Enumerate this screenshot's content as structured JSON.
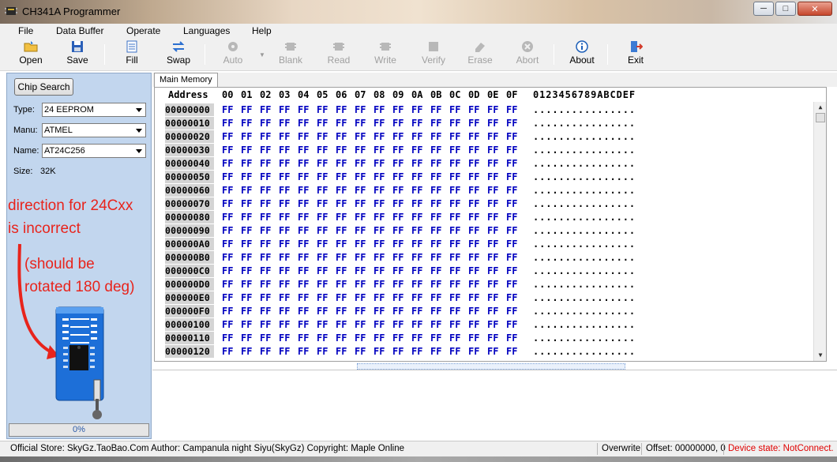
{
  "window": {
    "title": "CH341A Programmer",
    "controls": [
      "minimize",
      "maximize",
      "close"
    ]
  },
  "menu": [
    {
      "label": "File"
    },
    {
      "label": "Data Buffer"
    },
    {
      "label": "Operate"
    },
    {
      "label": "Languages"
    },
    {
      "label": "Help"
    }
  ],
  "toolbar": {
    "items": [
      {
        "label": "Open",
        "icon": "open-folder-icon",
        "enabled": true
      },
      {
        "label": "Save",
        "icon": "floppy-disk-icon",
        "enabled": true
      },
      {
        "label": "Fill",
        "icon": "fill-icon",
        "enabled": true
      },
      {
        "label": "Swap",
        "icon": "swap-arrows-icon",
        "enabled": true
      },
      {
        "label": "Auto",
        "icon": "auto-gear-icon",
        "enabled": false
      },
      {
        "label": "Blank",
        "icon": "blank-chip-icon",
        "enabled": false
      },
      {
        "label": "Read",
        "icon": "read-chip-icon",
        "enabled": false
      },
      {
        "label": "Write",
        "icon": "write-chip-icon",
        "enabled": false
      },
      {
        "label": "Verify",
        "icon": "verify-chip-icon",
        "enabled": false
      },
      {
        "label": "Erase",
        "icon": "erase-icon",
        "enabled": false
      },
      {
        "label": "Abort",
        "icon": "abort-icon",
        "enabled": false
      },
      {
        "label": "About",
        "icon": "info-icon",
        "enabled": true
      },
      {
        "label": "Exit",
        "icon": "exit-icon",
        "enabled": true
      }
    ]
  },
  "chip_panel": {
    "chip_search_label": "Chip Search",
    "type_label": "Type:",
    "type_value": "24 EEPROM",
    "manu_label": "Manu:",
    "manu_value": "ATMEL",
    "name_label": "Name:",
    "name_value": "AT24C256",
    "size_label": "Size:",
    "size_value": "32K",
    "annotation_line1": "direction for 24Cxx",
    "annotation_line2": "is incorrect",
    "annotation_line3": "(should be",
    "annotation_line4": "rotated 180 deg)",
    "progress_text": "0%",
    "progress_fraction": 0
  },
  "memory": {
    "tab_label": "Main Memory",
    "address_header": "Address",
    "column_headers": [
      "00",
      "01",
      "02",
      "03",
      "04",
      "05",
      "06",
      "07",
      "08",
      "09",
      "0A",
      "0B",
      "0C",
      "0D",
      "0E",
      "0F"
    ],
    "ascii_header": "0123456789ABCDEF",
    "rows": [
      {
        "address": "00000000",
        "ascii": "................"
      },
      {
        "address": "00000010",
        "ascii": "................"
      },
      {
        "address": "00000020",
        "ascii": "................"
      },
      {
        "address": "00000030",
        "ascii": "................"
      },
      {
        "address": "00000040",
        "ascii": "................"
      },
      {
        "address": "00000050",
        "ascii": "................"
      },
      {
        "address": "00000060",
        "ascii": "................"
      },
      {
        "address": "00000070",
        "ascii": "................"
      },
      {
        "address": "00000080",
        "ascii": "................"
      },
      {
        "address": "00000090",
        "ascii": "................"
      },
      {
        "address": "000000A0",
        "ascii": "................"
      },
      {
        "address": "000000B0",
        "ascii": "................"
      },
      {
        "address": "000000C0",
        "ascii": "................"
      },
      {
        "address": "000000D0",
        "ascii": "................"
      },
      {
        "address": "000000E0",
        "ascii": "................"
      },
      {
        "address": "000000F0",
        "ascii": "................"
      },
      {
        "address": "00000100",
        "ascii": "................"
      },
      {
        "address": "00000110",
        "ascii": "................"
      },
      {
        "address": "00000120",
        "ascii": "................"
      }
    ],
    "byte_value": "FF",
    "byte_color": "#0000c0"
  },
  "status": {
    "store_info": "Official Store: SkyGz.TaoBao.Com Author: Campanula night Siyu(SkyGz) Copyright: Maple Online",
    "mode": "Overwrite",
    "offset": "Offset: 00000000, 0",
    "device_state": "Device state: NotConnect.",
    "device_state_color": "#e00000"
  }
}
